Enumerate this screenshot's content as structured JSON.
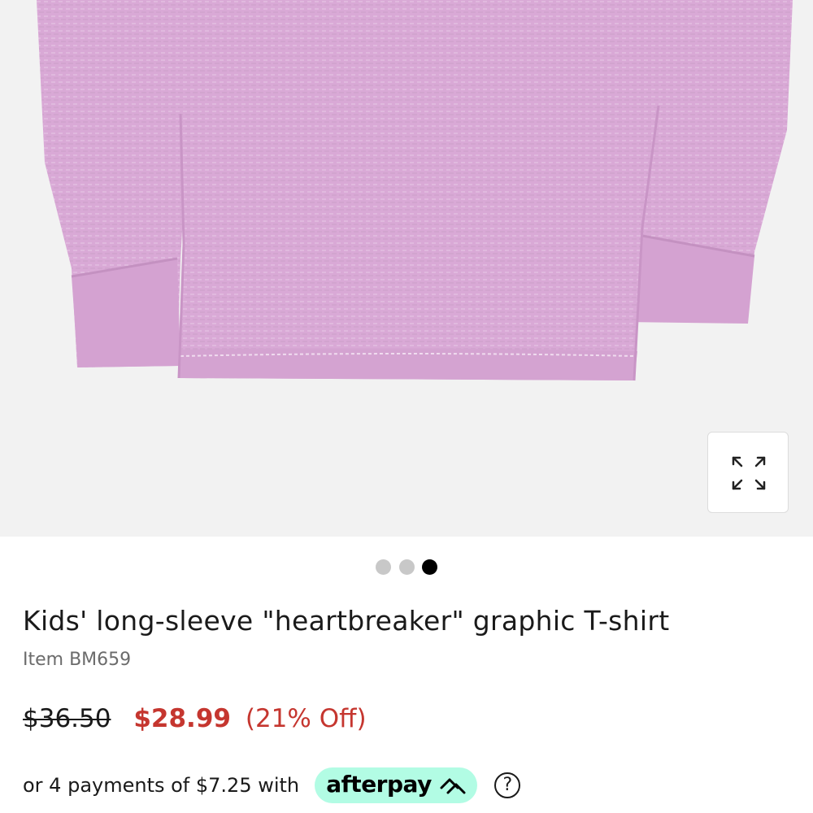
{
  "product_image": {
    "alt": "Lavender long-sleeve T-shirt",
    "colors": {
      "background": "#f2f2f2",
      "fabric": "#d9a9d6",
      "fabric_shadow": "#c995c6"
    },
    "expand_icon": "expand-arrows-icon"
  },
  "carousel": {
    "total": 3,
    "active_index": 2
  },
  "product": {
    "title": "Kids' long-sleeve \"heartbreaker\" graphic T-shirt",
    "item_number": "Item BM659"
  },
  "pricing": {
    "original_price": "$36.50",
    "sale_price": "$28.99",
    "discount": "(21% Off)",
    "sale_color": "#c5362f"
  },
  "afterpay": {
    "text": "or 4 payments of $7.25 with",
    "logo_text": "afterpay",
    "badge_color": "#b2fce4",
    "help_icon": "question-circle-icon",
    "help_glyph": "?"
  }
}
